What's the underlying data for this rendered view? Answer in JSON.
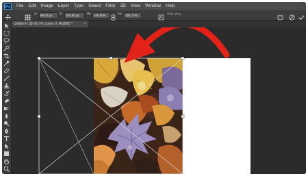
{
  "app": {
    "logo": "Ps"
  },
  "menu": [
    "File",
    "Edit",
    "Image",
    "Layer",
    "Type",
    "Select",
    "Filter",
    "3D",
    "View",
    "Window",
    "Help"
  ],
  "options": {
    "x_label": "X:",
    "x_value": "99.00 px",
    "y_label": "Y:",
    "y_value": "300.00 px",
    "w_label": "W:",
    "w_value": "100.00%",
    "h_label": "H:",
    "h_value": "104.17%",
    "antialias_label": "Anti-alias"
  },
  "document": {
    "tab_title": "Untitled-1 @ 66.7% (Layer 0, RGB/8) *",
    "close_glyph": "×"
  },
  "icons": {
    "logo": "photoshop-logo",
    "transform": "reference-point-icon",
    "warp": "warp-icon",
    "cancel": "cancel-transform-icon",
    "commit": "commit-transform-icon",
    "arrow": "red-curved-arrow"
  },
  "colors": {
    "arrow_red": "#e32219",
    "app_bg": "#282828",
    "panel": "#3c3c3c"
  }
}
